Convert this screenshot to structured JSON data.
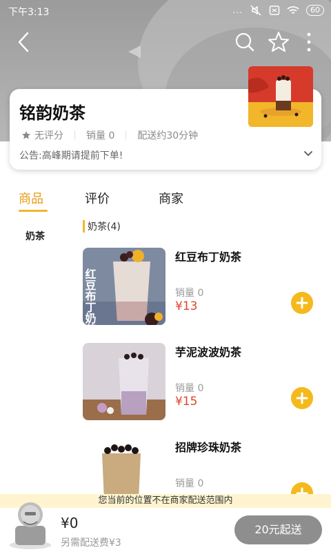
{
  "status_bar": {
    "time": "下午3:13",
    "signal": "...",
    "battery": "60"
  },
  "store": {
    "name": "铭韵奶茶",
    "rating": "无评分",
    "sales": "销量 0",
    "delivery": "配送约30分钟",
    "notice": "公告:高峰期请提前下单!"
  },
  "tabs": [
    {
      "label": "商品",
      "active": true
    },
    {
      "label": "评价",
      "active": false
    },
    {
      "label": "商家",
      "active": false
    }
  ],
  "sidebar": {
    "categories": [
      "奶茶"
    ]
  },
  "menu": {
    "category_header": "奶茶(4)",
    "items": [
      {
        "name": "红豆布丁奶茶",
        "sales": "销量 0",
        "price": "¥13",
        "image_text": "红豆布丁奶茶"
      },
      {
        "name": "芋泥波波奶茶",
        "sales": "销量 0",
        "price": "¥15"
      },
      {
        "name": "招牌珍珠奶茶",
        "sales": "销量 0",
        "price": ""
      }
    ]
  },
  "bottom": {
    "delivery_notice": "您当前的位置不在商家配送范围内",
    "total": "¥0",
    "extra_fee": "另需配送费¥3",
    "checkout_label": "20元起送"
  },
  "colors": {
    "accent": "#f1b52a",
    "price": "#e0452c",
    "checkout_bg": "#8e8e8e"
  }
}
